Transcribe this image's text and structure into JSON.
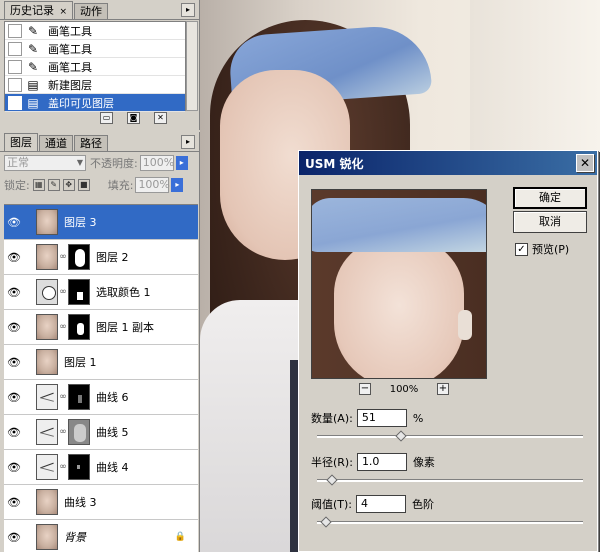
{
  "history": {
    "tabs": [
      "历史记录",
      "动作"
    ],
    "close_mark": "×",
    "items": [
      {
        "label": "画笔工具",
        "icon": "brush-icon"
      },
      {
        "label": "画笔工具",
        "icon": "brush-icon"
      },
      {
        "label": "画笔工具",
        "icon": "brush-icon"
      },
      {
        "label": "新建图层",
        "icon": "new-layer-icon"
      },
      {
        "label": "盖印可见图层",
        "icon": "stamp-visible-icon",
        "selected": true
      }
    ]
  },
  "layers": {
    "tabs": [
      "图层",
      "通道",
      "路径"
    ],
    "blend_mode": "正常",
    "opacity_label": "不透明度:",
    "opacity_value": "100%",
    "lock_label": "锁定:",
    "fill_label": "填充:",
    "fill_value": "100%",
    "items": [
      {
        "name": "图层 3",
        "selected": true
      },
      {
        "name": "图层 2",
        "mask": true
      },
      {
        "name": "选取颜色 1",
        "adjustment": true,
        "mask": true
      },
      {
        "name": "图层 1 副本",
        "mask": true
      },
      {
        "name": "图层 1"
      },
      {
        "name": "曲线 6",
        "adjustment": true,
        "mask": true
      },
      {
        "name": "曲线 5",
        "adjustment": true,
        "mask": true
      },
      {
        "name": "曲线 4",
        "adjustment": true,
        "mask": true
      },
      {
        "name": "曲线 3"
      },
      {
        "name": "背景",
        "italic": true,
        "locked": true
      }
    ]
  },
  "dialog": {
    "title": "USM 锐化",
    "ok_label": "确定",
    "cancel_label": "取消",
    "preview_label": "预览(P)",
    "preview_checked": true,
    "zoom_label": "100%",
    "amount": {
      "label": "数量(A):",
      "value": "51",
      "unit": "%",
      "level": 0.3
    },
    "radius": {
      "label": "半径(R):",
      "value": "1.0",
      "unit": "像素",
      "level": 0.04
    },
    "threshold": {
      "label": "阈值(T):",
      "value": "4",
      "unit": "色阶",
      "level": 0.02
    }
  }
}
